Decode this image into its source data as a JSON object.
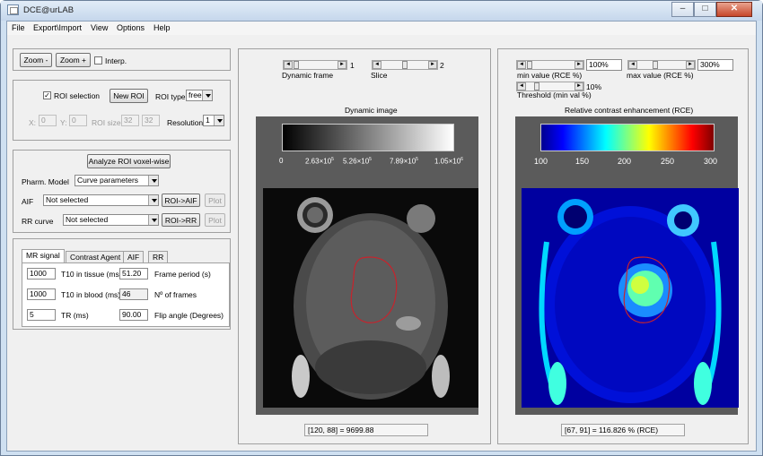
{
  "window": {
    "title": "DCE@urLAB",
    "minimize": "–",
    "maximize": "□",
    "close": "✕"
  },
  "menu": [
    "File",
    "Export\\Import",
    "View",
    "Options",
    "Help"
  ],
  "zoom": {
    "zoom_out": "Zoom -",
    "zoom_in": "Zoom +",
    "interp_label": "Interp.",
    "interp_checked": false
  },
  "roi": {
    "selection_label": "ROI selection",
    "selection_checked": true,
    "check_mark": "✓",
    "new_roi": "New ROI",
    "type_label": "ROI type",
    "type_value": "free",
    "x_label": "X:",
    "x_value": "0",
    "y_label": "Y:",
    "y_value": "0",
    "size_label": "ROI size",
    "size_w": "32",
    "size_h": "32",
    "resolution_label": "Resolution",
    "resolution_value": "1"
  },
  "analysis": {
    "analyze_button": "Analyze ROI voxel-wise",
    "pharm_label": "Pharm. Model",
    "pharm_value": "Curve parameters",
    "aif_label": "AIF",
    "aif_value": "Not selected",
    "roi_aif": "ROI->AIF",
    "plot1": "Plot",
    "rr_label": "RR curve",
    "rr_value": "Not selected",
    "roi_rr": "ROI->RR",
    "plot2": "Plot"
  },
  "params": {
    "tabs": [
      "MR signal",
      "Contrast Agent",
      "AIF",
      "RR"
    ],
    "t10_tissue": "1000",
    "t10_tissue_label": "T10 in tissue (ms)",
    "frame_period": "51.20",
    "frame_period_label": "Frame period (s)",
    "t10_blood": "1000",
    "t10_blood_label": "T10 in blood (ms)",
    "n_frames": "46",
    "n_frames_label": "Nº of frames",
    "tr": "5",
    "tr_label": "TR (ms)",
    "flip": "90.00",
    "flip_label": "Flip angle (Degrees)"
  },
  "dynamic": {
    "frame_label": "Dynamic frame",
    "frame_value": "1",
    "slice_label": "Slice",
    "slice_value": "2",
    "title": "Dynamic image",
    "colorbar_ticks": [
      "0",
      "2.63×10",
      "5.26×10",
      "7.89×10",
      "1.05×10"
    ],
    "colorbar_exps": [
      "",
      "5",
      "5",
      "5",
      "6"
    ],
    "readout": "[120, 88] = 9699.88"
  },
  "rce": {
    "min_label": "min value (RCE %)",
    "min_value": "100%",
    "max_label": "max value (RCE %)",
    "max_value": "300%",
    "threshold_label": "Threshold (min val %)",
    "threshold_value": "10%",
    "title": "Relative contrast enhancement (RCE)",
    "colorbar_ticks": [
      "100",
      "150",
      "200",
      "250",
      "300"
    ],
    "readout": "[67, 91] = 116.826 % (RCE)"
  },
  "slider_arrows": {
    "left": "◄",
    "right": "►"
  },
  "colors": {
    "roi_outline": "#c8232c",
    "window_frame": "#cfe0f1",
    "close_button": "#c6462a"
  }
}
